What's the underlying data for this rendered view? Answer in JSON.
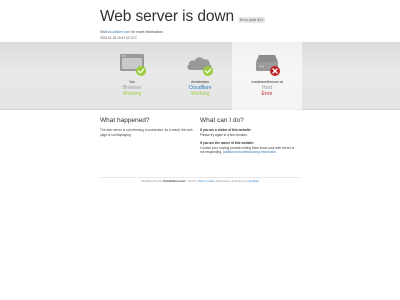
{
  "header": {
    "title": "Web server is down",
    "error_code": "Error code 521",
    "visit_prefix": "Visit",
    "visit_link": "cloudflare.com",
    "visit_suffix": "for more information.",
    "timestamp": "2024-01-28 20:47:42 UTC"
  },
  "nodes": [
    {
      "name": "You",
      "label": "Browser",
      "status": "Working",
      "label_color": "#999999",
      "status_color": "#9bca3e",
      "icon": "browser-ok-icon"
    },
    {
      "name": "Amsterdam",
      "label": "Cloudflare",
      "status": "Working",
      "label_color": "#2f7bbf",
      "status_color": "#9bca3e",
      "icon": "cloud-ok-icon"
    },
    {
      "name": "vocabwordforuser.at",
      "label": "Host",
      "status": "Error",
      "label_color": "#999999",
      "status_color": "#bd2426",
      "icon": "server-error-icon"
    }
  ],
  "what_happened": {
    "title": "What happened?",
    "body": "The web server is not returning a connection. As a result, the web page is not displaying."
  },
  "what_can_i_do": {
    "title": "What can I do?",
    "visitor_heading": "If you are a visitor of this website:",
    "visitor_body": "Please try again in a few minutes.",
    "owner_heading": "If you are the owner of this website:",
    "owner_body": "Contact your hosting provider letting them know your web server is not responding.",
    "owner_link": "Additional troubleshooting information."
  },
  "footer": {
    "ray_label": "Cloudflare Ray ID:",
    "ray_id": "84cb6f0b9c1ec0ef",
    "ip_prefix": "• Your IP:",
    "ip_link": "Click to reveal",
    "perf_prefix": "• Performance & security by",
    "perf_link": "Cloudflare"
  },
  "colors": {
    "link": "#2f7bbf",
    "working": "#9bca3e",
    "error": "#bd2426"
  }
}
